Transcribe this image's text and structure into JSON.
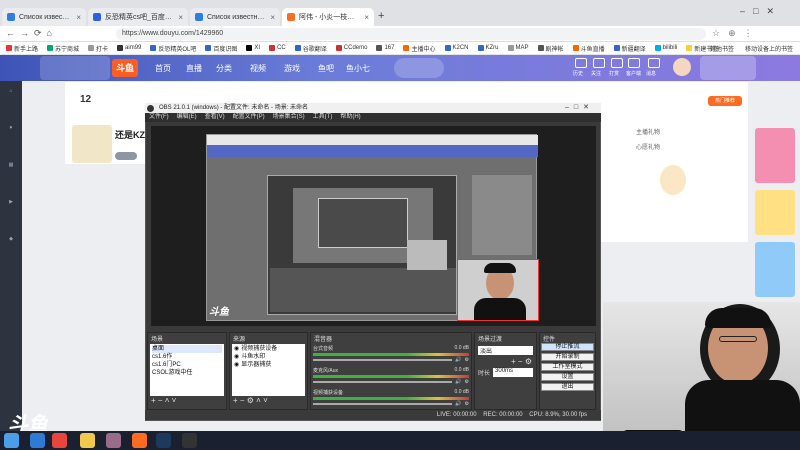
{
  "browser": {
    "tabs": [
      {
        "title": "Список известных нам карт",
        "color": "#2f7de1"
      },
      {
        "title": "反恐精英cs吧_百度贴吧 - 老玩",
        "color": "#2f5fe1"
      },
      {
        "title": "Список известных нам карт",
        "color": "#2f7de1"
      },
      {
        "title": "阿伟 - 小炎一枝直播_斗鱼精彩",
        "color": "#ff6b21",
        "active": true
      }
    ],
    "new_tab": "+",
    "url": "https://www.douyu.com/1429960",
    "bookmarks": [
      "新手上路",
      "苏宁商城",
      "打卡",
      "aim99",
      "反恐精英OL吧",
      "百度识图",
      "XI",
      "CC",
      "谷歌翻译",
      "CCdemo",
      "167",
      "主播中心",
      "K2CN",
      "KZru",
      "MAP",
      "剧神帐",
      "斗鱼直播",
      "新疆翻译",
      "bilibili",
      "新建书签"
    ],
    "bookmark_colors": [
      "#e33",
      "#0a7",
      "#999",
      "#333",
      "#36c",
      "#36c",
      "#000",
      "#c33",
      "#36c",
      "#c33",
      "#555",
      "#f60",
      "#36c",
      "#36c",
      "#999",
      "#555",
      "#f60",
      "#36c",
      "#0ae",
      "#fc3"
    ],
    "other_bookmarks": "其他书签",
    "mobile_bookmarks": "移动设备上的书签"
  },
  "douyu": {
    "logo": "斗鱼",
    "nav": [
      "首页",
      "直播",
      "分类",
      "视频",
      "游戏",
      "鱼吧",
      "鱼小七"
    ],
    "viewer_count": "12",
    "streamer_name": "还是KZ原",
    "right_icons": [
      "历史",
      "关注",
      "打赏",
      "客户端",
      "消息"
    ],
    "right_panel_tabs": [
      "主播礼物",
      "心愿礼物"
    ],
    "hot_label": "热门推荐"
  },
  "obs": {
    "title": "OBS 21.0.1 (windows) - 配置文件: 未命名 - 场景: 未命名",
    "menu": [
      "文件(F)",
      "编辑(E)",
      "查看(V)",
      "配置文件(P)",
      "场景集合(S)",
      "工具(T)",
      "帮助(H)"
    ],
    "docks": {
      "scenes": {
        "header": "场景",
        "items": [
          "桌面",
          "cs1.6作",
          "cs1.6门PC",
          "CSOL游戏中任"
        ]
      },
      "sources": {
        "header": "来源",
        "items": [
          "视频捕获设备",
          "斗鱼水印",
          "显示器捕获"
        ]
      },
      "mixer": {
        "header": "混音器",
        "channels": [
          {
            "name": "台式音频",
            "db": "0.0 dB"
          },
          {
            "name": "麦克风/Aux",
            "db": "0.0 dB"
          },
          {
            "name": "视频捕获设备",
            "db": "0.0 dB"
          }
        ]
      },
      "transitions": {
        "header": "场景过渡",
        "type": "淡出",
        "duration_label": "时长",
        "duration_value": "300ms"
      },
      "controls": {
        "header": "控件",
        "buttons": [
          "停止推流",
          "开始录制",
          "工作室模式",
          "设置",
          "退出"
        ]
      }
    },
    "status": "LIVE: 00:00:00    REC: 00:00:00    CPU: 8.9%, 30.00 fps"
  },
  "watermark": "斗鱼",
  "taskbar": {
    "icons": [
      "start",
      "ie",
      "chrome",
      "explorer",
      "anime",
      "douyu",
      "steam",
      "obs"
    ],
    "icon_colors": [
      "#4a9fe8",
      "#2e7bd6",
      "#e8453c",
      "#f2c94c",
      "#9b6b8a",
      "#ff6b21",
      "#1b3a5c",
      "#333"
    ]
  }
}
